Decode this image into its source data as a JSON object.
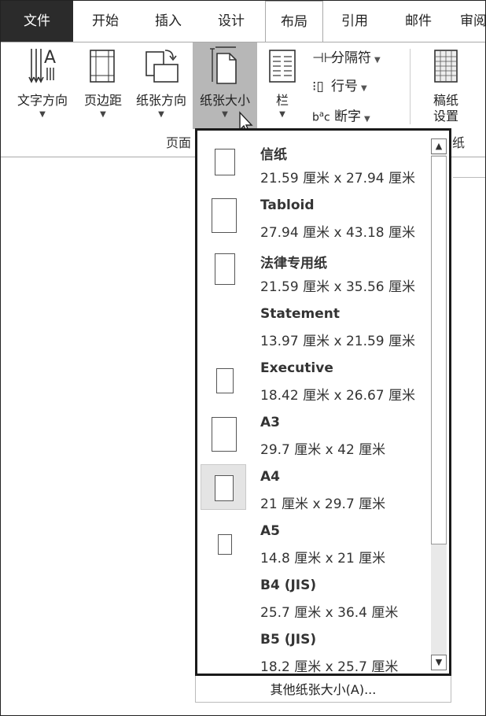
{
  "tabs": [
    {
      "label": "文件"
    },
    {
      "label": "开始"
    },
    {
      "label": "插入"
    },
    {
      "label": "设计"
    },
    {
      "label": "布局"
    },
    {
      "label": "引用"
    },
    {
      "label": "邮件"
    },
    {
      "label": "审阅"
    }
  ],
  "ribbon": {
    "text_direction": "文字方向",
    "margins": "页边距",
    "orientation": "纸张方向",
    "size": "纸张大小",
    "columns": "栏",
    "breaks": "分隔符",
    "line_numbers": "行号",
    "hyphenation": "断字",
    "manuscript_line1": "稿纸",
    "manuscript_line2": "设置",
    "group_page_setup": "页面",
    "group_manuscript": "纸"
  },
  "paper_sizes": [
    {
      "name": "信纸",
      "dims": "21.59 厘米 x 27.94 厘米"
    },
    {
      "name": "Tabloid",
      "dims": "27.94 厘米 x 43.18 厘米"
    },
    {
      "name": "法律专用纸",
      "dims": "21.59 厘米 x 35.56 厘米"
    },
    {
      "name": "Statement",
      "dims": "13.97 厘米 x 21.59 厘米"
    },
    {
      "name": "Executive",
      "dims": "18.42 厘米 x 26.67 厘米"
    },
    {
      "name": "A3",
      "dims": "29.7 厘米 x 42 厘米"
    },
    {
      "name": "A4",
      "dims": "21 厘米 x 29.7 厘米"
    },
    {
      "name": "A5",
      "dims": "14.8 厘米 x 21 厘米"
    },
    {
      "name": "B4 (JIS)",
      "dims": "25.7 厘米 x 36.4 厘米"
    },
    {
      "name": "B5 (JIS)",
      "dims": "18.2 厘米 x 25.7 厘米"
    }
  ],
  "selected_size": "A4",
  "more_sizes": "其他纸张大小(A)..."
}
